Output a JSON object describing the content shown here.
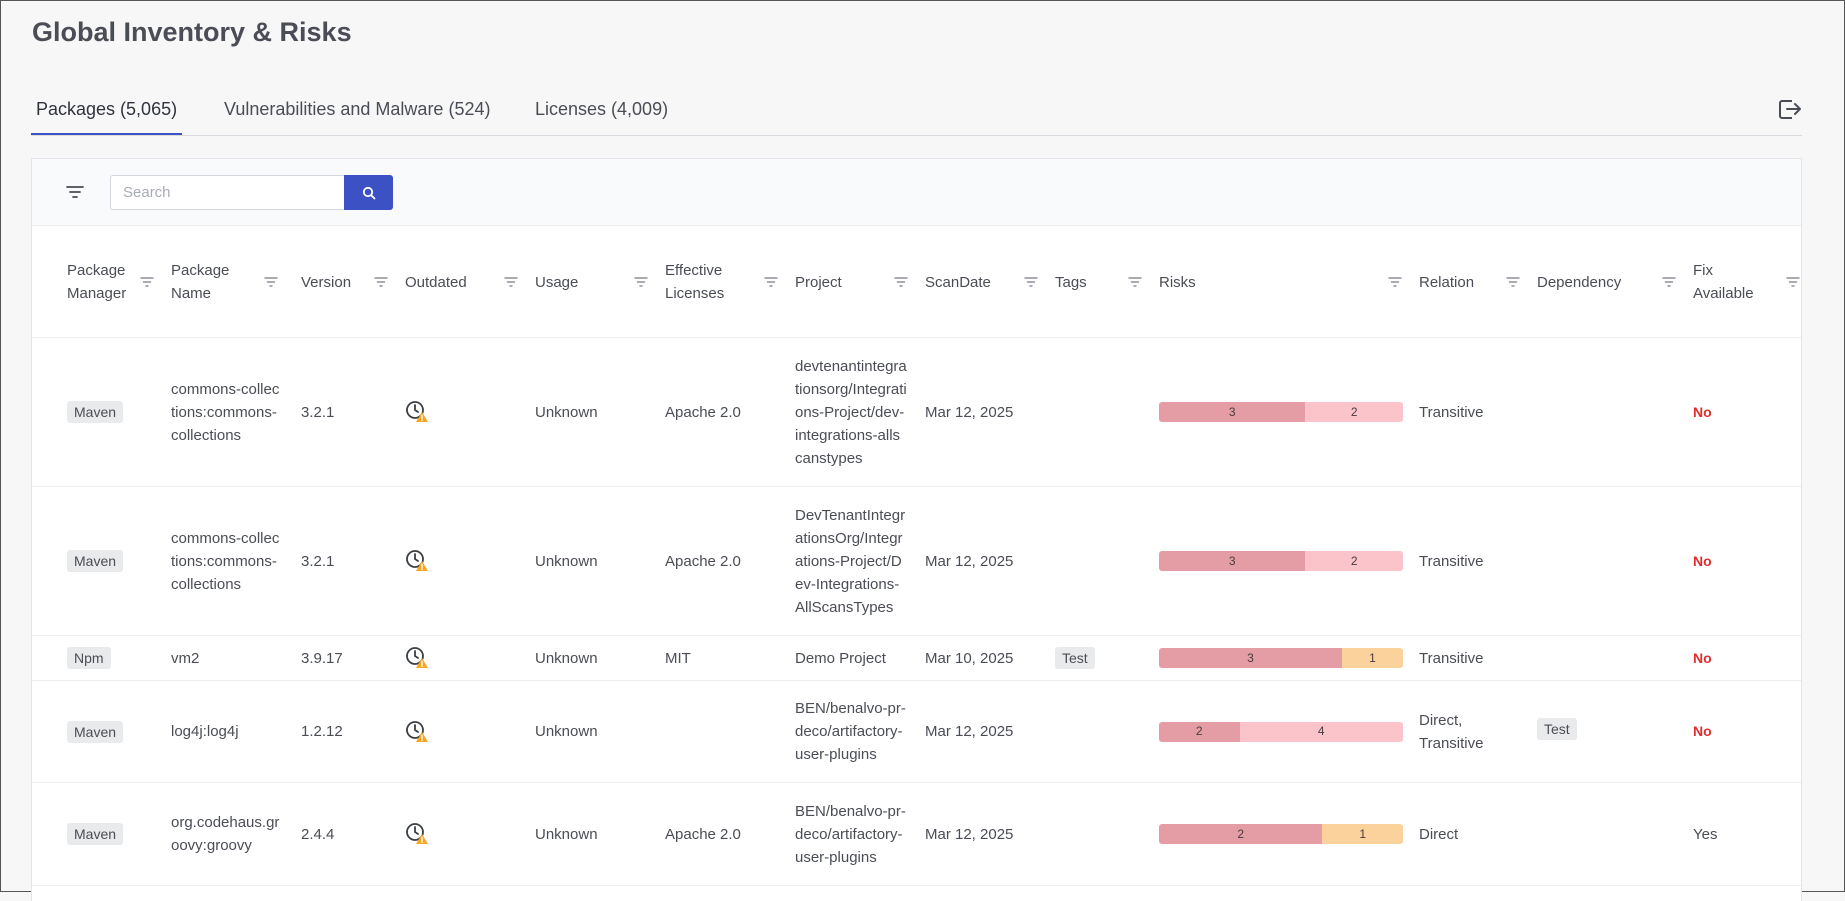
{
  "page": {
    "title": "Global Inventory & Risks"
  },
  "tabs": [
    {
      "label": "Packages (5,065)",
      "active": true
    },
    {
      "label": "Vulnerabilities and Malware (524)",
      "active": false
    },
    {
      "label": "Licenses (4,009)",
      "active": false
    }
  ],
  "search": {
    "placeholder": "Search",
    "value": ""
  },
  "icons": {
    "filter": "filter-icon",
    "search": "search-icon",
    "export": "export-icon",
    "outdated": "clock-warning-icon"
  },
  "colors": {
    "accent": "#3b51c4",
    "risk_critical": "#e49da4",
    "risk_high": "#fbc4cb",
    "risk_medium": "#fbd29b",
    "fix_no": "#e02d2d"
  },
  "columns": [
    {
      "key": "manager",
      "label": "Package Manager"
    },
    {
      "key": "name",
      "label": "Package Name"
    },
    {
      "key": "version",
      "label": "Version"
    },
    {
      "key": "outdated",
      "label": "Outdated"
    },
    {
      "key": "usage",
      "label": "Usage"
    },
    {
      "key": "licenses",
      "label": "Effective Licenses"
    },
    {
      "key": "project",
      "label": "Project"
    },
    {
      "key": "scandate",
      "label": "ScanDate"
    },
    {
      "key": "tags",
      "label": "Tags"
    },
    {
      "key": "risks",
      "label": "Risks"
    },
    {
      "key": "relation",
      "label": "Relation"
    },
    {
      "key": "dependency",
      "label": "Dependency"
    },
    {
      "key": "fix",
      "label": "Fix Available"
    }
  ],
  "rows": [
    {
      "manager": "Maven",
      "name": "commons-collections:commons-collections",
      "version": "3.2.1",
      "usage": "Unknown",
      "licenses": "Apache 2.0",
      "project": "devtenantintegrationsorg/Integrations-Project/dev-integrations-allscanstypes",
      "scandate": "Mar 12, 2025",
      "tags": "",
      "risks": [
        {
          "level": "critical",
          "count": 3
        },
        {
          "level": "high",
          "count": 2
        }
      ],
      "relation": "Transitive",
      "dependency": "",
      "fix": "No"
    },
    {
      "manager": "Maven",
      "name": "commons-collections:commons-collections",
      "version": "3.2.1",
      "usage": "Unknown",
      "licenses": "Apache 2.0",
      "project": "DevTenantIntegrationsOrg/Integrations-Project/Dev-Integrations-AllScansTypes",
      "scandate": "Mar 12, 2025",
      "tags": "",
      "risks": [
        {
          "level": "critical",
          "count": 3
        },
        {
          "level": "high",
          "count": 2
        }
      ],
      "relation": "Transitive",
      "dependency": "",
      "fix": "No"
    },
    {
      "manager": "Npm",
      "name": "vm2",
      "version": "3.9.17",
      "usage": "Unknown",
      "licenses": "MIT",
      "project": "Demo Project",
      "scandate": "Mar 10, 2025",
      "tags": "Test",
      "risks": [
        {
          "level": "critical",
          "count": 3
        },
        {
          "level": "medium",
          "count": 1
        }
      ],
      "relation": "Transitive",
      "dependency": "",
      "fix": "No"
    },
    {
      "manager": "Maven",
      "name": "log4j:log4j",
      "version": "1.2.12",
      "usage": "Unknown",
      "licenses": "",
      "project": "BEN/benalvo-pr-deco/artifactory-user-plugins",
      "scandate": "Mar 12, 2025",
      "tags": "",
      "risks": [
        {
          "level": "critical",
          "count": 2
        },
        {
          "level": "high",
          "count": 4
        }
      ],
      "relation": "Direct, Transitive",
      "dependency": "Test",
      "fix": "No"
    },
    {
      "manager": "Maven",
      "name": "org.codehaus.groovy:groovy",
      "version": "2.4.4",
      "usage": "Unknown",
      "licenses": "Apache 2.0",
      "project": "BEN/benalvo-pr-deco/artifactory-user-plugins",
      "scandate": "Mar 12, 2025",
      "tags": "",
      "risks": [
        {
          "level": "critical",
          "count": 2
        },
        {
          "level": "medium",
          "count": 1
        }
      ],
      "relation": "Direct",
      "dependency": "",
      "fix": "Yes"
    }
  ]
}
